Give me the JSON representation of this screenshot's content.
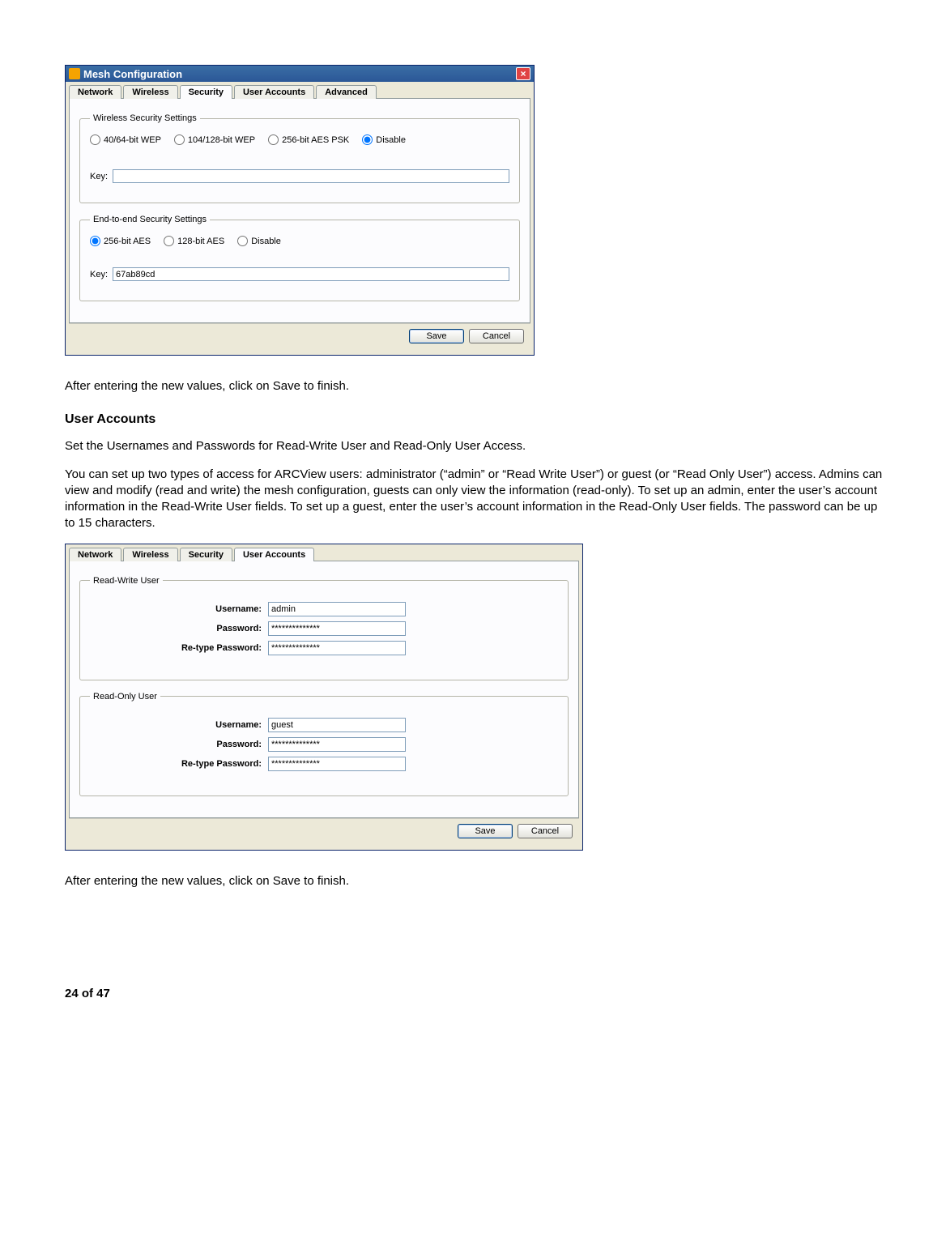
{
  "doc": {
    "prose_after_save_1": "After entering the new values, click on Save to finish.",
    "section_heading": "User Accounts",
    "prose_set_usernames": "Set the Usernames and Passwords for Read-Write User and Read-Only User Access.",
    "prose_body": "You can set up two types of access for ARCView users: administrator (“admin” or “Read Write User”) or guest (or “Read Only User”) access. Admins can view and modify (read and write) the mesh configuration, guests can only view the information (read-only). To set up an admin, enter the user’s account information in the Read-Write User fields. To set up a guest, enter the user’s account information in the Read-Only User fields. The password can be up to 15 characters.",
    "prose_after_save_2": "After entering the new values, click on Save to finish.",
    "page_number": "24 of 47"
  },
  "win1": {
    "title": "Mesh Configuration",
    "tabs": [
      "Network",
      "Wireless",
      "Security",
      "User Accounts",
      "Advanced"
    ],
    "active_tab_index": 2,
    "wireless_group": {
      "legend": "Wireless Security Settings",
      "options": [
        "40/64-bit WEP",
        "104/128-bit WEP",
        "256-bit AES PSK",
        "Disable"
      ],
      "selected_index": 3,
      "key_label": "Key:",
      "key_value": ""
    },
    "e2e_group": {
      "legend": "End-to-end Security Settings",
      "options": [
        "256-bit AES",
        "128-bit AES",
        "Disable"
      ],
      "selected_index": 0,
      "key_label": "Key:",
      "key_value": "67ab89cd"
    },
    "buttons": {
      "save": "Save",
      "cancel": "Cancel"
    }
  },
  "win2": {
    "tabs": [
      "Network",
      "Wireless",
      "Security",
      "User Accounts"
    ],
    "active_tab_index": 3,
    "rw_group": {
      "legend": "Read-Write User",
      "username_label": "Username:",
      "username_value": "admin",
      "password_label": "Password:",
      "password_value": "**************",
      "retype_label": "Re-type Password:",
      "retype_value": "**************"
    },
    "ro_group": {
      "legend": "Read-Only User",
      "username_label": "Username:",
      "username_value": "guest",
      "password_label": "Password:",
      "password_value": "**************",
      "retype_label": "Re-type Password:",
      "retype_value": "**************"
    },
    "buttons": {
      "save": "Save",
      "cancel": "Cancel"
    }
  }
}
